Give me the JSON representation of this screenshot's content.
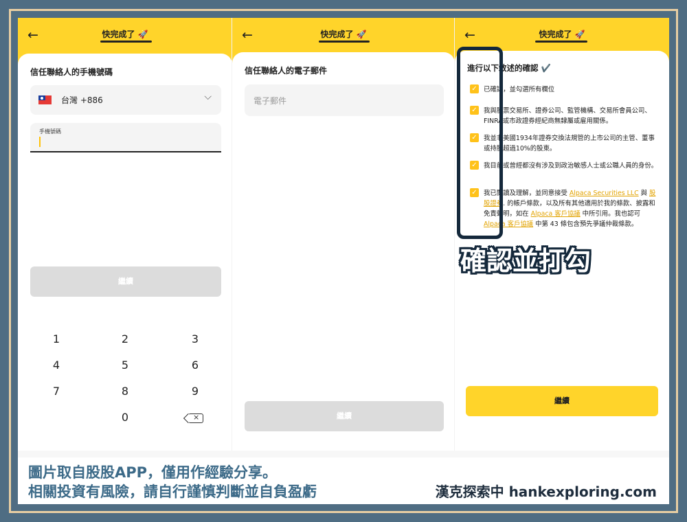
{
  "panel1": {
    "back": "←",
    "title": "快完成了 🚀",
    "label": "信任聯絡人的手機號碼",
    "country": "台灣 +886",
    "phone_label": "手機號碼",
    "continue": "繼續",
    "keys": [
      "1",
      "2",
      "3",
      "4",
      "5",
      "6",
      "7",
      "8",
      "9",
      "0"
    ]
  },
  "panel2": {
    "back": "←",
    "title": "快完成了 🚀",
    "label": "信任聯絡人的電子郵件",
    "email_placeholder": "電子郵件",
    "continue": "繼續"
  },
  "panel3": {
    "back": "←",
    "title": "快完成了 🚀",
    "heading": "進行以下敘述的確認 ✔️",
    "items": [
      "已確認，並勾選所有欄位",
      "我與股票交易所、證券公司、監管機構、交易所會員公司、FINRA或市政證券經紀商無隸屬或雇用關係。",
      "我並非美國1934年證券交換法規管的上市公司的主管、董事或持股超過10%的股東。",
      "我目前或曾經都沒有涉及到政治敏感人士或公職人員的身份。"
    ],
    "item5": {
      "a": "我已閱讀及理解，並同意接受 ",
      "link1": "Alpaca Securities LLC",
      "b": " 與 ",
      "link2": "股股證券",
      "c": ". 的帳戶條款，以及所有其他適用於我的條款、披露和免責聲明，如在 ",
      "link3": "Alpaca 客戶協議",
      "d": " 中所引用。我也認可 ",
      "link4": "Alpaca 客戶協議",
      "e": " 中第 43 條包含預先爭議仲裁條款。"
    },
    "continue": "繼續"
  },
  "annotation": "確認並打勾",
  "footer": {
    "line1": "圖片取自股股APP，僅用作經驗分享。",
    "line2": "相關投資有風險，請自行謹慎判斷並自負盈虧",
    "brand": "漢克探索中 hankexploring.com"
  }
}
